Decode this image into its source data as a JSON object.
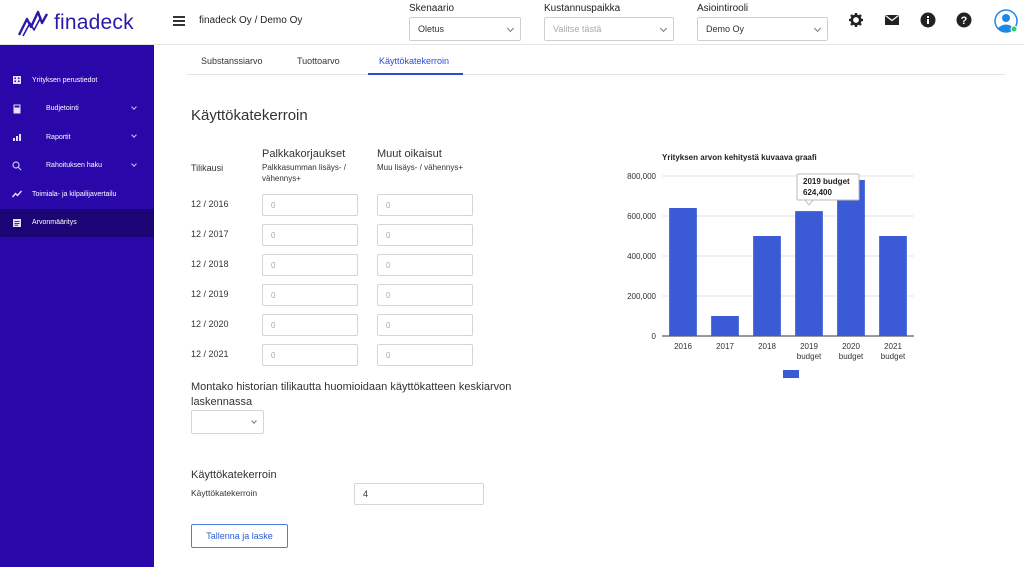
{
  "brand": {
    "name": "finadeck"
  },
  "header": {
    "company": "finadeck Oy / Demo Oy",
    "selects": [
      {
        "label": "Skenaario",
        "value": "Oletus",
        "placeholder": false
      },
      {
        "label": "Kustannuspaikka",
        "value": "Valitse tästä",
        "placeholder": true
      },
      {
        "label": "Asiointirooli",
        "value": "Demo Oy",
        "placeholder": false
      }
    ],
    "icons": [
      "gear-icon",
      "mail-icon",
      "info-icon",
      "help-icon",
      "avatar-icon"
    ]
  },
  "sidebar": {
    "items": [
      {
        "label": "Yrityksen perustiedot",
        "icon": "building-icon",
        "expandable": false,
        "active": false
      },
      {
        "label": "Budjetointi",
        "icon": "calculator-icon",
        "expandable": true,
        "active": false
      },
      {
        "label": "Raportit",
        "icon": "bar-chart-icon",
        "expandable": true,
        "active": false
      },
      {
        "label": "Rahoituksen haku",
        "icon": "search-icon",
        "expandable": true,
        "active": false
      },
      {
        "label": "Toimiala- ja kilpailijavertailu",
        "icon": "trend-icon",
        "expandable": false,
        "active": false
      },
      {
        "label": "Arvonmääritys",
        "icon": "document-icon",
        "expandable": false,
        "active": true
      }
    ]
  },
  "tabs": [
    {
      "label": "Substanssiarvo",
      "active": false
    },
    {
      "label": "Tuottoarvo",
      "active": false
    },
    {
      "label": "Käyttökatekerroin",
      "active": true
    }
  ],
  "main": {
    "title": "Käyttökatekerroin",
    "table": {
      "col_period": "Tilikausi",
      "col1_header": "Palkkakorjaukset",
      "col1_sub": "Palkkasumman lisäys- / vähennys+",
      "col2_header": "Muut oikaisut",
      "col2_sub": "Muu lisäys- / vähennys+",
      "rows": [
        {
          "period": "12 / 2016",
          "v1": "0",
          "v2": "0"
        },
        {
          "period": "12 / 2017",
          "v1": "0",
          "v2": "0"
        },
        {
          "period": "12 / 2018",
          "v1": "0",
          "v2": "0"
        },
        {
          "period": "12 / 2019",
          "v1": "0",
          "v2": "0"
        },
        {
          "period": "12 / 2020",
          "v1": "0",
          "v2": "0"
        },
        {
          "period": "12 / 2021",
          "v1": "0",
          "v2": "0"
        }
      ]
    },
    "history_question": "Montako historian tilikautta huomioidaan käyttökatteen keskiarvon laskennassa",
    "multiplier": {
      "title": "Käyttökatekerroin",
      "label": "Käyttökatekerroin",
      "value": "4"
    },
    "save_label": "Tallenna ja laske"
  },
  "chart_data": {
    "type": "bar",
    "title": "Yrityksen arvon kehitystä kuvaava graafi",
    "categories": [
      "2016",
      "2017",
      "2018",
      "2019 budget",
      "2020 budget",
      "2021 budget"
    ],
    "category_lines": [
      [
        "2016"
      ],
      [
        "2017"
      ],
      [
        "2018"
      ],
      [
        "2019",
        "budget"
      ],
      [
        "2020",
        "budget"
      ],
      [
        "2021",
        "budget"
      ]
    ],
    "values": [
      640000,
      100000,
      500000,
      624400,
      780000,
      500000
    ],
    "ylim": [
      0,
      800000
    ],
    "yticks": [
      "0",
      "200,000",
      "400,000",
      "600,000",
      "800,000"
    ],
    "ytick_values": [
      0,
      200000,
      400000,
      600000,
      800000
    ],
    "bar_color": "#3b5bd6",
    "tooltip": {
      "category": "2019 budget",
      "value": "624,400"
    },
    "legend_placement": "bottom",
    "grid": true
  }
}
